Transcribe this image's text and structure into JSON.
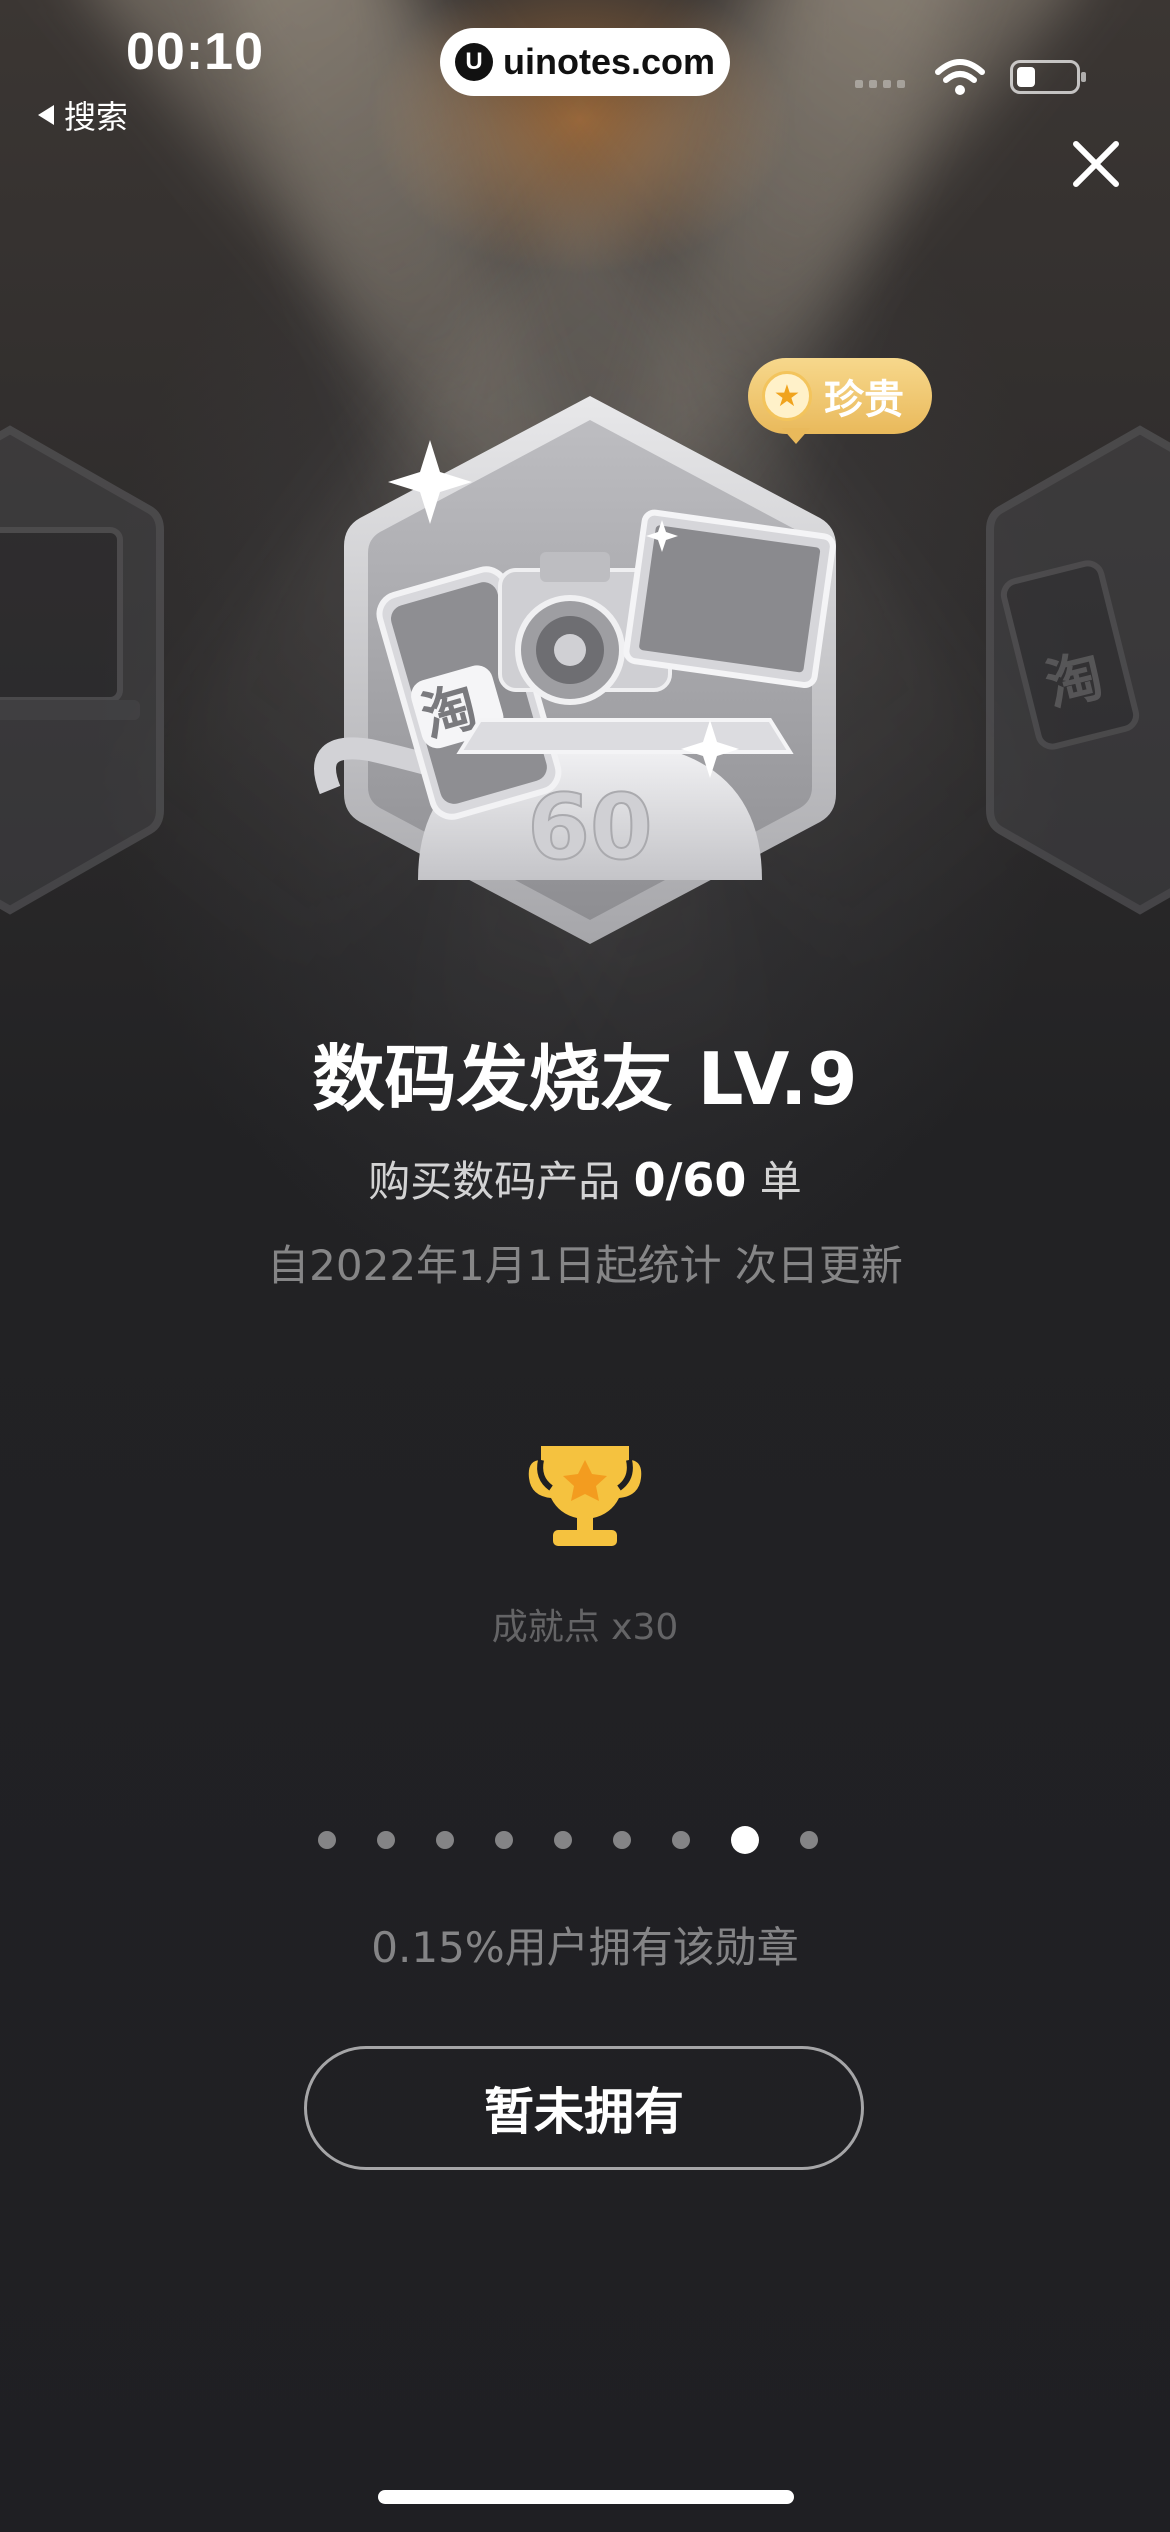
{
  "status_bar": {
    "time": "00:10",
    "back_label": "搜索",
    "url": "uinotes.com",
    "url_logo": "U"
  },
  "badge": {
    "rarity_label": "珍贵",
    "medal_number": "60",
    "medal_glyph": "淘",
    "title": "数码发烧友 LV.9",
    "progress_prefix": "购买数码产品",
    "progress_value": "0/60",
    "progress_suffix": "单",
    "stat_note": "自2022年1月1日起统计 次日更新"
  },
  "reward": {
    "icon": "trophy-icon",
    "points_label": "成就点 x30"
  },
  "pager": {
    "count": 9,
    "active_index": 7
  },
  "ownership": {
    "percent_text": "0.15%用户拥有该勋章"
  },
  "action": {
    "button_label": "暂未拥有"
  },
  "colors": {
    "rare_gold": "#e9b95b",
    "trophy_gold": "#f5c23f",
    "background": "#1e1e22"
  }
}
